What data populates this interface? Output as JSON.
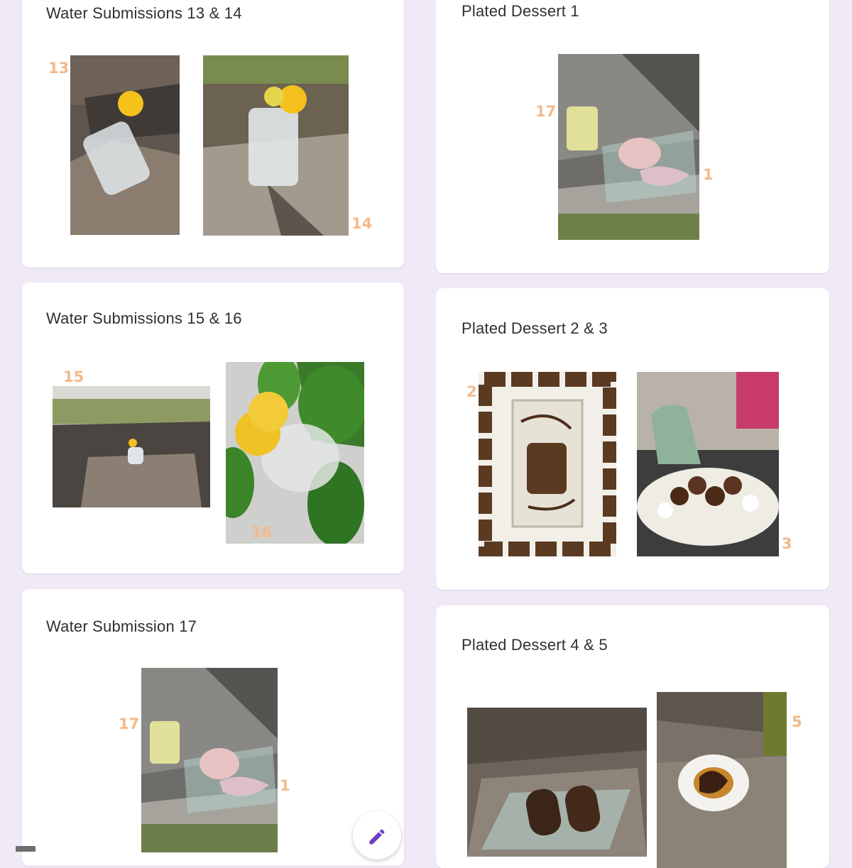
{
  "cards": {
    "water_13_14": {
      "title": "Water Submissions 13 & 14",
      "labels": [
        "13",
        "14"
      ]
    },
    "water_15_16": {
      "title": "Water Submissions 15 & 16",
      "labels": [
        "15",
        "16"
      ]
    },
    "water_17": {
      "title": "Water Submission 17",
      "labels": [
        "17",
        "1"
      ]
    },
    "dessert_1": {
      "title": "Plated Dessert 1",
      "labels": [
        "17",
        "1"
      ]
    },
    "dessert_2_3": {
      "title": "Plated Dessert 2 & 3",
      "labels": [
        "2",
        "3"
      ]
    },
    "dessert_4_5": {
      "title": "Plated Dessert 4 & 5",
      "labels": [
        "5"
      ]
    }
  },
  "fab": {
    "icon": "pencil-icon"
  },
  "colors": {
    "background": "#efeaf6",
    "card": "#ffffff",
    "number_label": "#f3b98a",
    "fab_icon": "#6a3fc1"
  }
}
